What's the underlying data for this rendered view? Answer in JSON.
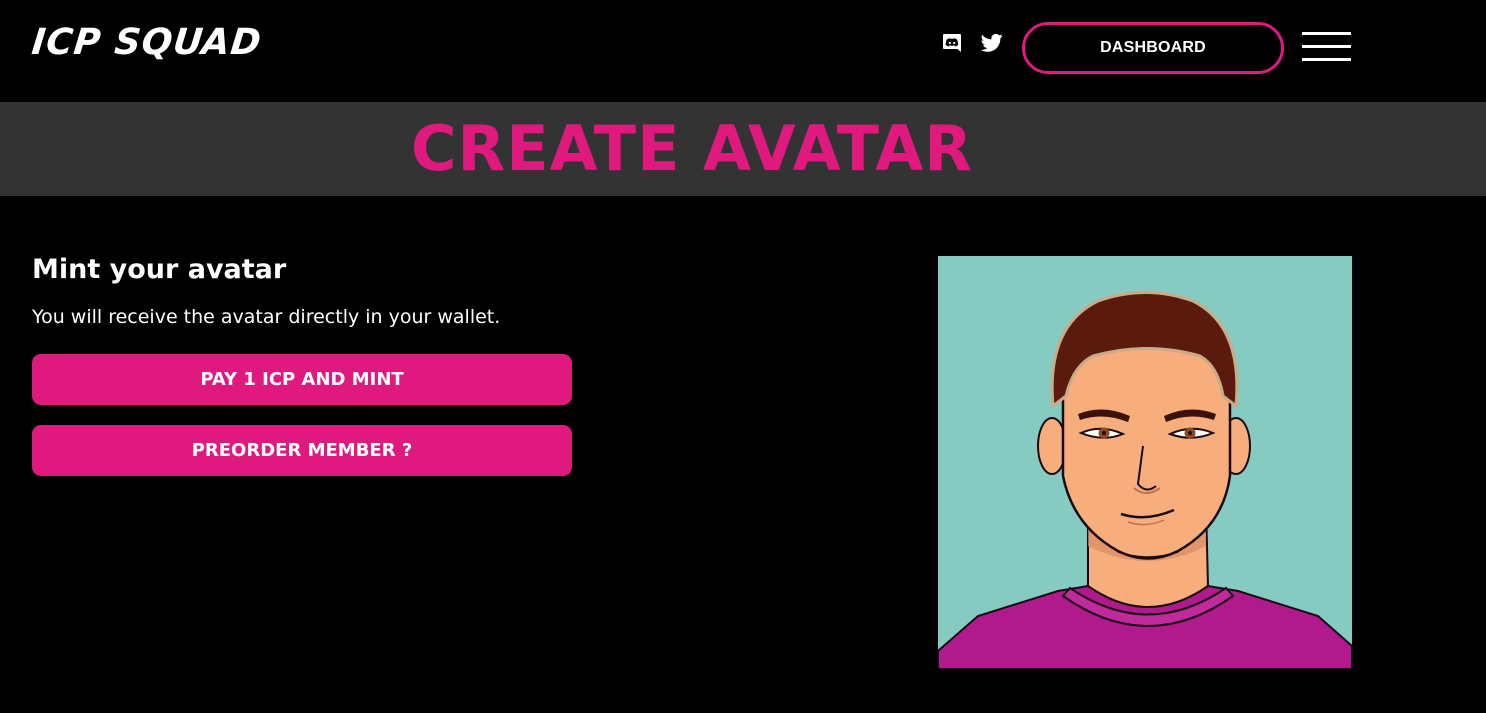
{
  "header": {
    "logo_text": "ICP SQUAD",
    "social": [
      {
        "name": "discord",
        "icon": "discord-icon"
      },
      {
        "name": "twitter",
        "icon": "twitter-icon"
      }
    ],
    "dashboard_label": "DASHBOARD",
    "menu_icon": "hamburger-menu-icon"
  },
  "title_band": {
    "title": "CREATE AVATAR"
  },
  "mint": {
    "heading": "Mint your avatar",
    "description": "You will receive the avatar directly in your wallet.",
    "pay_button_label": "PAY 1 ICP AND MINT",
    "preorder_button_label": "PREORDER MEMBER ?"
  },
  "avatar": {
    "background": "#86cbc2"
  },
  "colors": {
    "accent": "#e0197f",
    "background": "#000000",
    "band": "#333333",
    "text": "#ffffff"
  }
}
